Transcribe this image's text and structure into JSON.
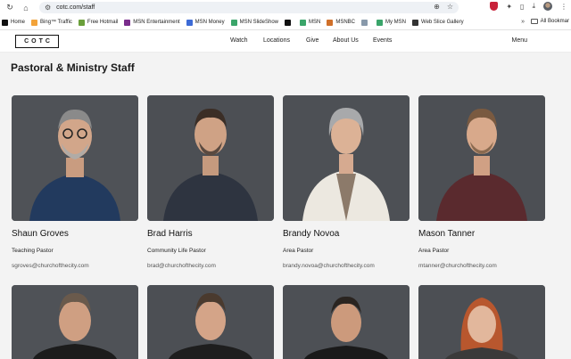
{
  "browser": {
    "url": "cotc.com/staff",
    "bookmarks": [
      {
        "label": "Home",
        "color": "#111111"
      },
      {
        "label": "Bing™ Traffic",
        "color": "#f2a33a"
      },
      {
        "label": "Free Hotmail",
        "color": "#6a9f3a"
      },
      {
        "label": "MSN Entertainment",
        "color": "#7a2d8c"
      },
      {
        "label": "MSN Money",
        "color": "#3d6bd6"
      },
      {
        "label": "MSN SlideShow",
        "color": "#3aa56a"
      },
      {
        "label": "",
        "color": "#111111"
      },
      {
        "label": "MSN",
        "color": "#3aa56a"
      },
      {
        "label": "MSNBC",
        "color": "#d0702a"
      },
      {
        "label": "",
        "color": "#8899aa"
      },
      {
        "label": "My MSN",
        "color": "#3aa56a"
      },
      {
        "label": "Web Slice Gallery",
        "color": "#333333"
      }
    ],
    "more": "»",
    "all_bookmarks": "All Bookmar"
  },
  "header": {
    "logo": "COTC",
    "nav": [
      "Watch",
      "Locations",
      "Give",
      "About Us",
      "Events"
    ],
    "menu": "Menu"
  },
  "page_title": "Pastoral & Ministry Staff",
  "staff": [
    {
      "name": "Shaun Groves",
      "role": "Teaching Pastor",
      "email": "sgroves@churchofthecity.com"
    },
    {
      "name": "Brad Harris",
      "role": "Community Life Pastor",
      "email": "brad@churchofthecity.com"
    },
    {
      "name": "Brandy Novoa",
      "role": "Area Pastor",
      "email": "brandy.novoa@churchofthecity.com"
    },
    {
      "name": "Mason Tanner",
      "role": "Area Pastor",
      "email": "mtanner@churchofthecity.com"
    }
  ],
  "colors": {
    "accent": "#111111",
    "background": "#f3f3f3",
    "photo_bg": "#4a4d52"
  }
}
